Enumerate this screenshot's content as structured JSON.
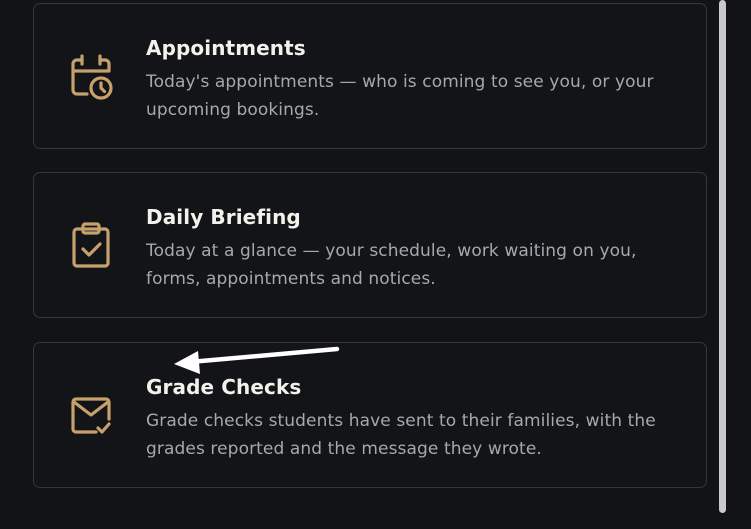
{
  "cards": [
    {
      "title": "Appointments",
      "description": "Today's appointments — who is coming to see you, or your upcoming bookings.",
      "icon": "calendar-clock-icon"
    },
    {
      "title": "Daily Briefing",
      "description": "Today at a glance — your schedule, work waiting on you, forms, appointments and notices.",
      "icon": "clipboard-check-icon"
    },
    {
      "title": "Grade Checks",
      "description": "Grade checks students have sent to their families, with the grades reported and the message they wrote.",
      "icon": "mail-check-icon"
    }
  ],
  "colors": {
    "background": "#121316",
    "card_border": "#34363b",
    "icon_accent": "#c6a16c",
    "title_text": "#f3f1ec",
    "description_text": "#a7a8ad",
    "scrollbar_thumb": "#c9c9cb",
    "annotation_arrow": "#ffffff"
  }
}
